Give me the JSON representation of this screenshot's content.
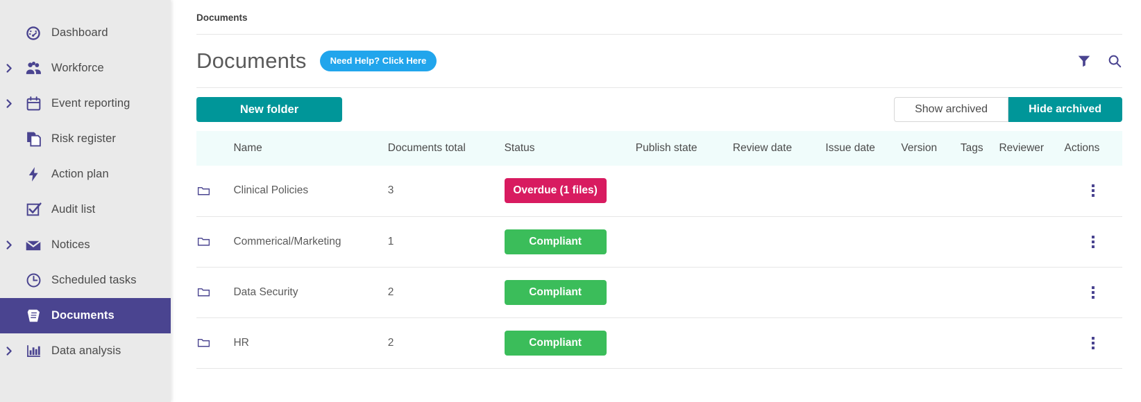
{
  "sidebar": {
    "items": [
      {
        "label": "Dashboard",
        "icon": "gauge-icon",
        "expandable": false,
        "active": false
      },
      {
        "label": "Workforce",
        "icon": "people-icon",
        "expandable": true,
        "active": false
      },
      {
        "label": "Event reporting",
        "icon": "calendar-icon",
        "expandable": true,
        "active": false
      },
      {
        "label": "Risk register",
        "icon": "documents-icon",
        "expandable": false,
        "active": false
      },
      {
        "label": "Action plan",
        "icon": "bolt-icon",
        "expandable": false,
        "active": false
      },
      {
        "label": "Audit list",
        "icon": "checkbox-icon",
        "expandable": false,
        "active": false
      },
      {
        "label": "Notices",
        "icon": "envelope-icon",
        "expandable": true,
        "active": false
      },
      {
        "label": "Scheduled tasks",
        "icon": "clock-icon",
        "expandable": false,
        "active": false
      },
      {
        "label": "Documents",
        "icon": "book-icon",
        "expandable": false,
        "active": true
      },
      {
        "label": "Data analysis",
        "icon": "bar-chart-icon",
        "expandable": true,
        "active": false
      }
    ]
  },
  "breadcrumb": "Documents",
  "header": {
    "title": "Documents",
    "help_badge": "Need Help? Click Here",
    "filter_icon": "funnel-icon",
    "search_icon": "search-icon"
  },
  "toolbar": {
    "new_folder_label": "New folder",
    "show_archived_label": "Show archived",
    "hide_archived_label": "Hide archived",
    "archived_active": "hide"
  },
  "table": {
    "columns": [
      "Name",
      "Documents total",
      "Status",
      "Publish state",
      "Review date",
      "Issue date",
      "Version",
      "Tags",
      "Reviewer",
      "Actions"
    ],
    "rows": [
      {
        "name": "Clinical Policies",
        "documents_total": "3",
        "status": "Overdue (1 files)",
        "status_type": "overdue",
        "publish_state": "",
        "review_date": "",
        "issue_date": "",
        "version": "",
        "tags": "",
        "reviewer": ""
      },
      {
        "name": "Commerical/Marketing",
        "documents_total": "1",
        "status": "Compliant",
        "status_type": "compliant",
        "publish_state": "",
        "review_date": "",
        "issue_date": "",
        "version": "",
        "tags": "",
        "reviewer": ""
      },
      {
        "name": "Data Security",
        "documents_total": "2",
        "status": "Compliant",
        "status_type": "compliant",
        "publish_state": "",
        "review_date": "",
        "issue_date": "",
        "version": "",
        "tags": "",
        "reviewer": ""
      },
      {
        "name": "HR",
        "documents_total": "2",
        "status": "Compliant",
        "status_type": "compliant",
        "publish_state": "",
        "review_date": "",
        "issue_date": "",
        "version": "",
        "tags": "",
        "reviewer": ""
      }
    ]
  },
  "colors": {
    "sidebar_bg": "#eaeaea",
    "sidebar_active": "#4a4490",
    "accent_purple": "#4a4490",
    "teal": "#009699",
    "blue_badge": "#21a5ec",
    "overdue_pink": "#d81b60",
    "compliant_green": "#3bbd5a",
    "table_header_bg": "#f0fcfb"
  }
}
